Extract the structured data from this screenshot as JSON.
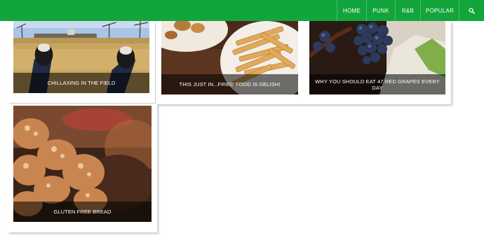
{
  "theme": {
    "accent": "#12a53c"
  },
  "nav": {
    "items": [
      {
        "label": "HOME"
      },
      {
        "label": "PUNK"
      },
      {
        "label": "R&B"
      },
      {
        "label": "POPULAR"
      }
    ],
    "search_icon": "search-icon"
  },
  "posts": [
    {
      "caption": "CHILLAXING IN THE FIELD"
    },
    {
      "caption": "THIS JUST IN...FRIED FOOD IS DELISH!"
    },
    {
      "caption": "WHY YOU SHOULD EAT 47 RED GRAPES EVERY DAY"
    },
    {
      "caption": "GLUTEN FREE BREAD"
    }
  ]
}
